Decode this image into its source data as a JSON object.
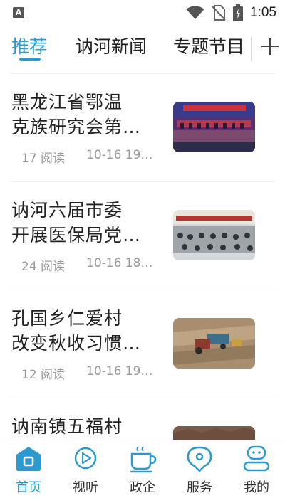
{
  "status_bar": {
    "app_icon_letter": "A",
    "time": "1:05"
  },
  "tabs": [
    {
      "label": "推荐",
      "active": true
    },
    {
      "label": "讷河新闻",
      "active": false
    },
    {
      "label": "专题节目",
      "active": false
    }
  ],
  "add_tab_icon": "plus-icon",
  "news": [
    {
      "title_line1": "黑龙江省鄂温",
      "title_line2": "克族研究会第…",
      "views": "17 阅读",
      "date": "10-16 19…",
      "thumb": "conference-stage-photo"
    },
    {
      "title_line1": "讷河六届市委",
      "title_line2": "开展医保局党…",
      "views": "24 阅读",
      "date": "10-16 18…",
      "thumb": "meeting-hall-photo"
    },
    {
      "title_line1": "孔国乡仁爱村",
      "title_line2": "改变秋收习惯…",
      "views": "12 阅读",
      "date": "10-16 19…",
      "thumb": "farm-field-tractor-photo"
    },
    {
      "title_line1": "讷南镇五福村",
      "title_line2": "",
      "views": "",
      "date": "",
      "thumb": "outdoor-photo"
    }
  ],
  "bottom_nav": [
    {
      "label": "首页",
      "icon": "home-icon",
      "active": true
    },
    {
      "label": "视听",
      "icon": "play-icon",
      "active": false
    },
    {
      "label": "政企",
      "icon": "coffee-cup-icon",
      "active": false
    },
    {
      "label": "服务",
      "icon": "location-pin-icon",
      "active": false
    },
    {
      "label": "我的",
      "icon": "profile-icon",
      "active": false
    }
  ],
  "colors": {
    "accent": "#2a9ad0",
    "text": "#222222",
    "muted": "#999999",
    "divider": "#ececec"
  }
}
